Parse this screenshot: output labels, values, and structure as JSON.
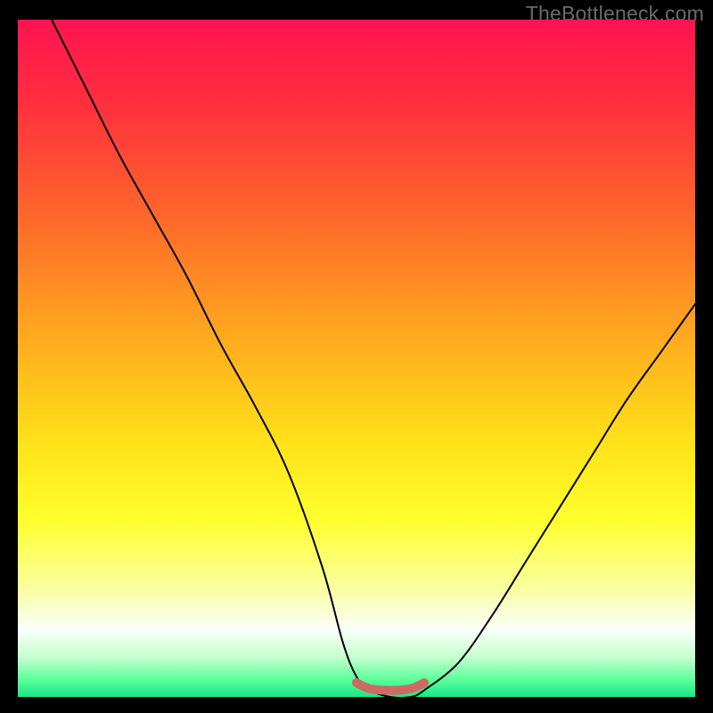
{
  "watermark": "TheBottleneck.com",
  "colors": {
    "frame_bg": "#000000",
    "watermark_text": "#6a6a6a",
    "curve_stroke": "#000000",
    "band_stroke": "#cc6a63",
    "gradient_stops": [
      {
        "offset": 0.0,
        "color": "#ff1450"
      },
      {
        "offset": 0.12,
        "color": "#ff2e3e"
      },
      {
        "offset": 0.3,
        "color": "#ff6a2a"
      },
      {
        "offset": 0.48,
        "color": "#ffae1e"
      },
      {
        "offset": 0.62,
        "color": "#ffe019"
      },
      {
        "offset": 0.74,
        "color": "#ffff2d"
      },
      {
        "offset": 0.84,
        "color": "#faffa0"
      },
      {
        "offset": 0.9,
        "color": "#fafffa"
      },
      {
        "offset": 0.94,
        "color": "#c8ffd0"
      },
      {
        "offset": 0.975,
        "color": "#5aff9a"
      },
      {
        "offset": 1.0,
        "color": "#18e888"
      }
    ]
  },
  "chart_data": {
    "type": "line",
    "title": "",
    "xlabel": "",
    "ylabel": "",
    "xlim": [
      0,
      100
    ],
    "ylim": [
      0,
      100
    ],
    "grid": false,
    "series": [
      {
        "name": "bottleneck-curve",
        "x": [
          5,
          10,
          15,
          20,
          25,
          30,
          35,
          40,
          45,
          48,
          50,
          52,
          55,
          58,
          60,
          65,
          70,
          75,
          80,
          85,
          90,
          95,
          100
        ],
        "y": [
          100,
          90,
          80,
          71,
          62,
          52,
          43,
          33,
          19,
          8,
          3,
          1,
          0,
          0,
          1,
          5,
          12,
          20,
          28,
          36,
          44,
          51,
          58
        ]
      }
    ],
    "annotations": [
      {
        "name": "optimal-band",
        "x_range": [
          50,
          60
        ],
        "y": 1.5
      }
    ]
  }
}
